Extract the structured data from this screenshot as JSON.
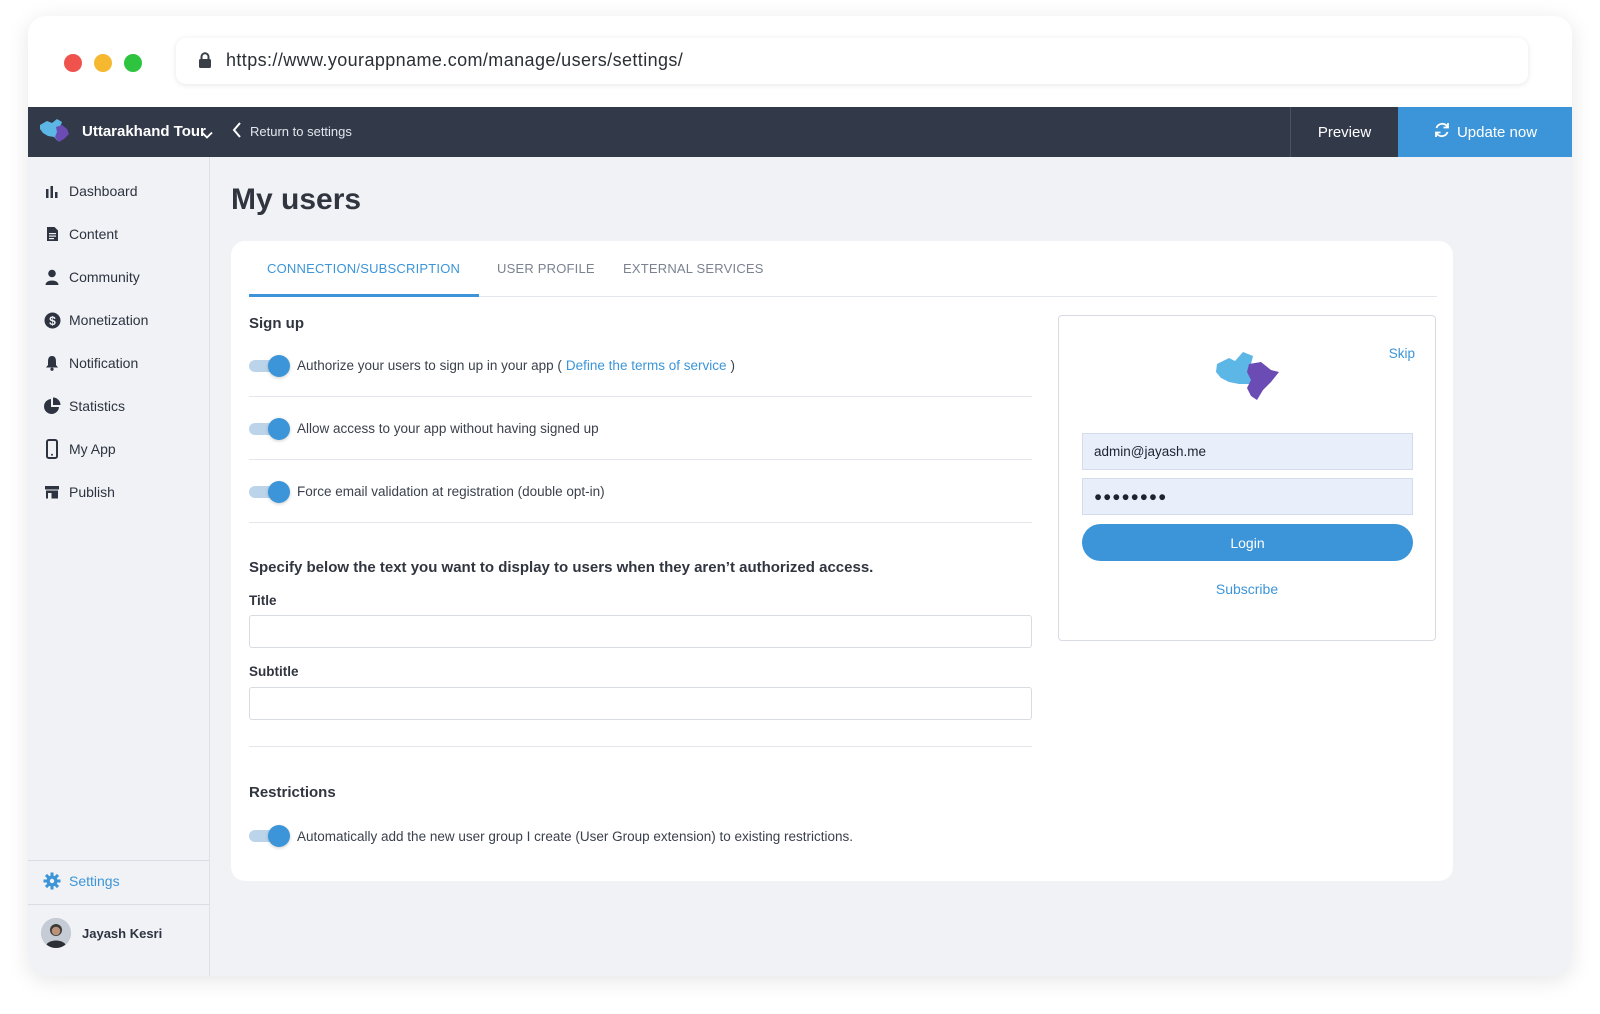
{
  "browser": {
    "url": "https://www.yourappname.com/manage/users/settings/"
  },
  "appbar": {
    "app_name": "Uttarakhand Tour",
    "return_label": "Return to settings",
    "preview_label": "Preview",
    "update_label": "Update now"
  },
  "sidebar": {
    "items": [
      {
        "label": "Dashboard",
        "icon": "bar-chart-icon"
      },
      {
        "label": "Content",
        "icon": "document-icon"
      },
      {
        "label": "Community",
        "icon": "person-icon"
      },
      {
        "label": "Monetization",
        "icon": "dollar-icon"
      },
      {
        "label": "Notification",
        "icon": "bell-icon"
      },
      {
        "label": "Statistics",
        "icon": "pie-chart-icon"
      },
      {
        "label": "My App",
        "icon": "phone-icon"
      },
      {
        "label": "Publish",
        "icon": "store-icon"
      }
    ],
    "settings_label": "Settings",
    "user_name": "Jayash Kesri"
  },
  "main": {
    "title": "My users",
    "tabs": [
      {
        "label": "CONNECTION/SUBSCRIPTION",
        "active": true
      },
      {
        "label": "USER PROFILE",
        "active": false
      },
      {
        "label": "EXTERNAL SERVICES",
        "active": false
      }
    ],
    "signup": {
      "heading": "Sign up",
      "toggle1_text": "Authorize your users to sign up in your app (",
      "toggle1_link": "Define the terms of service",
      "toggle1_end": ")",
      "toggle2_text": "Allow access to your app without having signed up",
      "toggle3_text": "Force email validation at registration (double opt-in)"
    },
    "unauthorized": {
      "heading": "Specify below the text you want to display to users when they aren’t authorized access.",
      "title_label": "Title",
      "title_value": "",
      "subtitle_label": "Subtitle",
      "subtitle_value": ""
    },
    "restrictions": {
      "heading": "Restrictions",
      "toggle_text": "Automatically add the new user group I create (User Group extension) to existing restrictions."
    },
    "preview": {
      "skip_label": "Skip",
      "email_value": "admin@jayash.me",
      "password_value": "●●●●●●●●",
      "login_label": "Login",
      "subscribe_label": "Subscribe"
    }
  },
  "colors": {
    "accent": "#3c95d8",
    "appbar": "#323a4a",
    "sidebar_bg": "#f0f2f5"
  }
}
